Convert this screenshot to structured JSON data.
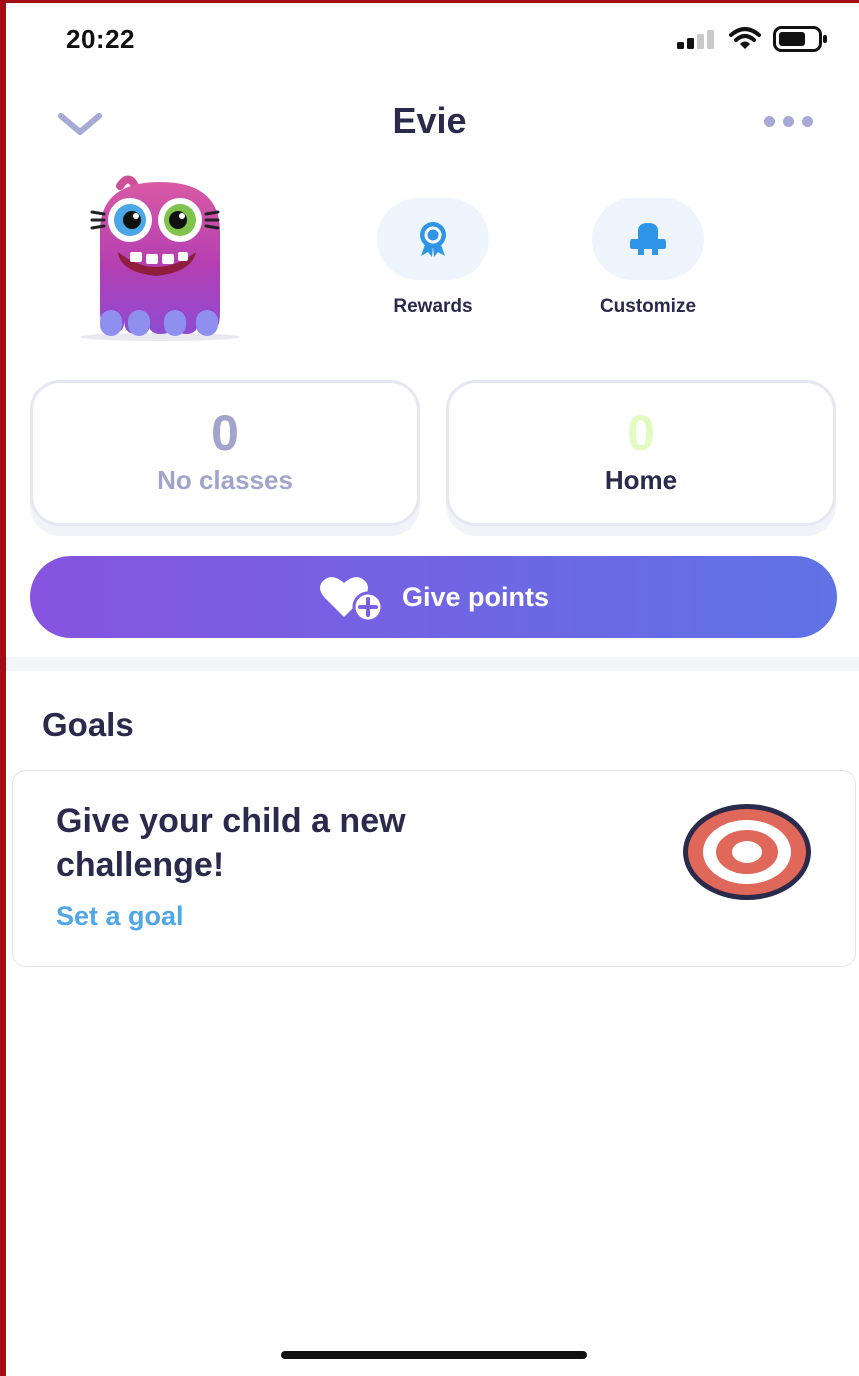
{
  "status_bar": {
    "time": "20:22"
  },
  "header": {
    "title": "Evie"
  },
  "actions": {
    "rewards_label": "Rewards",
    "customize_label": "Customize"
  },
  "stats": {
    "classes": {
      "value": "0",
      "label": "No classes"
    },
    "home": {
      "value": "0",
      "label": "Home"
    }
  },
  "give_points": {
    "label": "Give points"
  },
  "goals": {
    "heading": "Goals",
    "card_title": "Give your child a new challenge!",
    "link": "Set a goal"
  },
  "colors": {
    "primary_text": "#2b2a4c",
    "accent_purple": "#7b5fe2",
    "link_blue": "#4fa7e6",
    "muted": "#a2a5cb"
  },
  "icons": [
    "chevron-down-icon",
    "more-icon",
    "rewards-icon",
    "customize-icon",
    "heart-plus-icon",
    "target-icon",
    "signal-icon",
    "wifi-icon",
    "battery-icon"
  ]
}
